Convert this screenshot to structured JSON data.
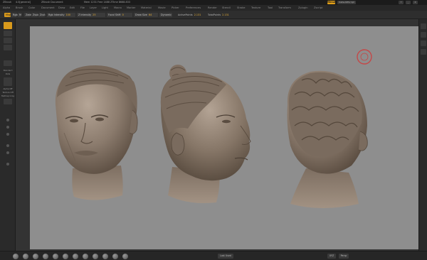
{
  "titlebar": {
    "app": "ZBrush",
    "app_version": "4.0[general]",
    "doc_title": "ZBrush Document",
    "mem_info": "Mem 1231 Free 1488 ZTime 8668.833",
    "ui_chip": "Menus",
    "buttons": [
      "DefaultZScript",
      "?",
      "_",
      "X"
    ]
  },
  "menubar": {
    "items": [
      "Alpha",
      "Brush",
      "Color",
      "Document",
      "Draw",
      "Edit",
      "File",
      "Layer",
      "Light",
      "Macro",
      "Marker",
      "Material",
      "Movie",
      "Picker",
      "Preferences",
      "Render",
      "Stencil",
      "Stroke",
      "Texture",
      "Tool",
      "Transform",
      "Zplugin",
      "Zscript"
    ]
  },
  "shelf": {
    "mrgb": "Mrgb",
    "rgb": "Rgb",
    "m": "M",
    "zadd": "Zadd",
    "zsub": "Zsub",
    "zcut": "Zcut",
    "rgb_intensity_label": "Rgb Intensity",
    "rgb_intensity_value": "100",
    "z_intensity_label": "Z Intensity",
    "z_intensity_value": "25",
    "focal_shift_label": "Focal Shift",
    "focal_shift_value": "0",
    "draw_size_label": "Draw Size",
    "draw_size_value": "64",
    "dynamic_label": "Dynamic",
    "active_points_label": "ActivePoints",
    "active_points_value": "2.131",
    "total_points_label": "TotalPoints",
    "total_points_value": "2.131"
  },
  "lefttray": {
    "brush_label": "Standard",
    "stroke_label": "Dots",
    "alpha_label": "Alpha Off",
    "texture_label": "Texture Off",
    "material_label": "MatCap Gray"
  },
  "bottombar": {
    "center_label": "Last Used",
    "right_labels": [
      "XYZ",
      "Persp"
    ]
  },
  "colors": {
    "accent": "#d99a1c",
    "canvas_bg": "#8e8e8e",
    "clay": "#8a7a6c",
    "cursor_ring": "#c44848"
  }
}
